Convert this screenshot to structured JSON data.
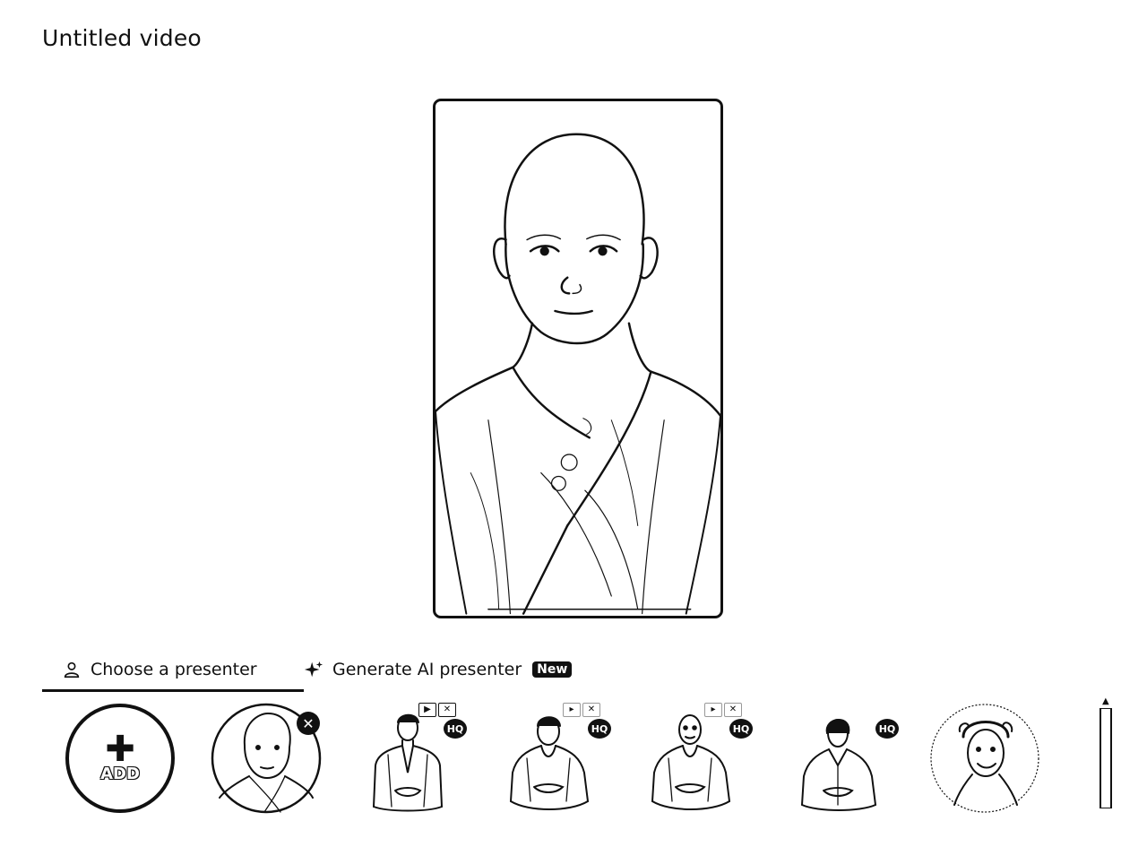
{
  "header": {
    "title": "Untitled video"
  },
  "tabs": {
    "choose_label": "Choose a presenter",
    "generate_label": "Generate AI presenter",
    "new_badge": "New"
  },
  "strip": {
    "add_label": "ADD",
    "presenters": [
      {
        "name": "monk-child",
        "quality": ""
      },
      {
        "name": "man-suit-1",
        "quality": "HQ"
      },
      {
        "name": "man-suit-2",
        "quality": "HQ"
      },
      {
        "name": "man-suit-3",
        "quality": "HQ"
      },
      {
        "name": "woman-blouse",
        "quality": "HQ"
      },
      {
        "name": "woman-curly",
        "quality": ""
      }
    ],
    "hq_label": "HQ"
  },
  "colors": {
    "ink": "#111111",
    "background": "#ffffff"
  }
}
